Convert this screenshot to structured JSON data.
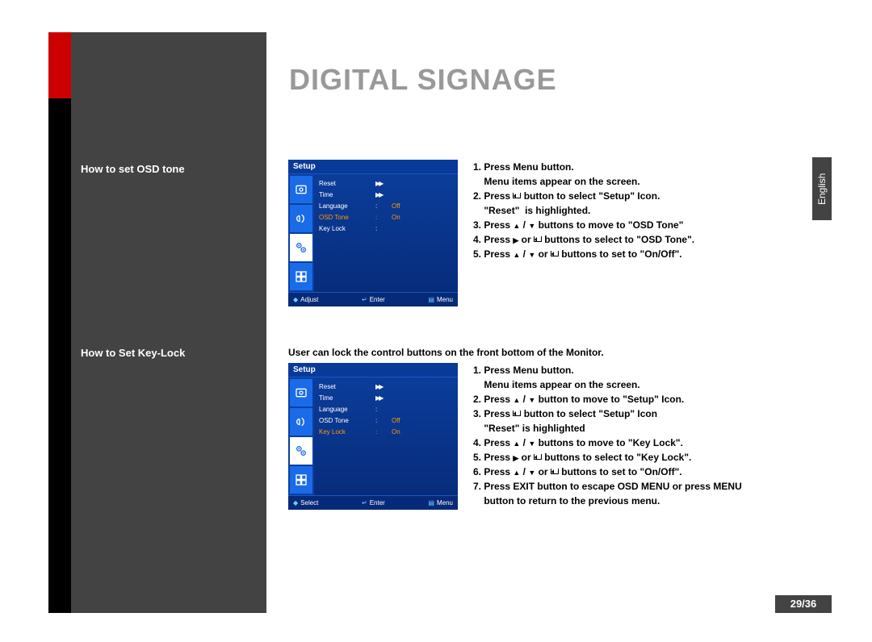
{
  "title": "DIGITAL SIGNAGE",
  "language_tab": "English",
  "page_number": "29/36",
  "sidebar": {
    "heading1": "How to set OSD tone",
    "heading2": "How to Set Key-Lock"
  },
  "osd1": {
    "header": "Setup",
    "rows": [
      {
        "label": "Reset",
        "sep": "▶▶",
        "val": "",
        "hl": false
      },
      {
        "label": "Time",
        "sep": "▶▶",
        "val": "",
        "hl": false
      },
      {
        "label": "Language",
        "sep": ":",
        "val": "Off",
        "hl": false
      },
      {
        "label": "OSD Tone",
        "sep": ":",
        "val": "On",
        "hl": true
      },
      {
        "label": "Key Lock",
        "sep": ":",
        "val": "",
        "hl": false
      }
    ],
    "footer": {
      "adjust": "Adjust",
      "enter": "Enter",
      "menu": "Menu"
    }
  },
  "osd2": {
    "header": "Setup",
    "rows": [
      {
        "label": "Reset",
        "sep": "▶▶",
        "val": "",
        "hl": false
      },
      {
        "label": "Time",
        "sep": "▶▶",
        "val": "",
        "hl": false
      },
      {
        "label": "Language",
        "sep": ":",
        "val": "",
        "hl": false
      },
      {
        "label": "OSD Tone",
        "sep": ":",
        "val": "Off",
        "hl": false
      },
      {
        "label": "Key Lock",
        "sep": ":",
        "val": "On",
        "hl": true
      }
    ],
    "footer": {
      "adjust": "Select",
      "enter": "Enter",
      "menu": "Menu"
    }
  },
  "section2_intro": "User can lock the control buttons on the front bottom of the Monitor.",
  "instr1": {
    "l1": "1. Press Menu button.",
    "l1b": "    Menu items appear on the screen.",
    "l2a": "2. Press ",
    "l2b": " button to select \"Setup\" Icon.",
    "l2c": "    \"Reset\"  is highlighted.",
    "l3a": "3. Press ",
    "l3b": " buttons to move to \"OSD Tone\"",
    "l4a": "4. Press ",
    "l4b": " or ",
    "l4c": " buttons to select to \"OSD Tone\".",
    "l5a": "5. Press ",
    "l5b": " or ",
    "l5c": " buttons to set  to \"On/Off\"."
  },
  "instr2": {
    "l1": "1. Press Menu button.",
    "l1b": "    Menu items appear on the screen.",
    "l2a": "2. Press ",
    "l2b": " button to move to \"Setup\" Icon.",
    "l3a": "3. Press ",
    "l3b": " button to select \"Setup\" Icon",
    "l3c": "    \"Reset\" is highlighted",
    "l4a": "4. Press ",
    "l4b": " buttons to move to \"Key Lock\".",
    "l5a": "5. Press ",
    "l5b": " or ",
    "l5c": "  buttons to select to \"Key Lock\".",
    "l6a": "6. Press ",
    "l6b": " or ",
    "l6c": " buttons to set to \"On/Off\".",
    "l7a": "7. Press EXIT button to escape OSD MENU or press MENU",
    "l7b": "    button to return to the previous menu."
  }
}
